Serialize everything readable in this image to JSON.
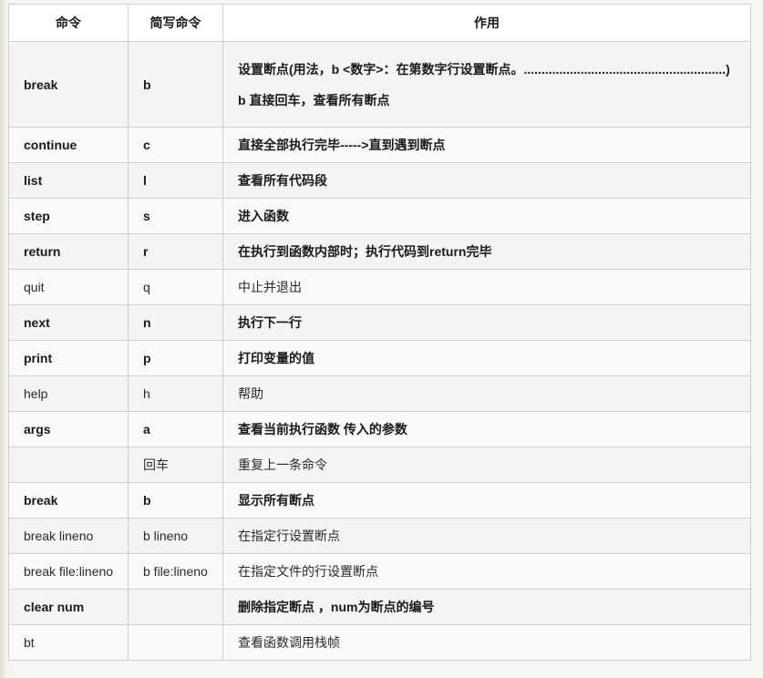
{
  "header": {
    "col1": "命令",
    "col2": "简写命令",
    "col3": "作用"
  },
  "rows": [
    {
      "cmd": "break",
      "short": "b",
      "desc": [
        "设置断点(用法，b <数字>：在第数字行设置断点。.........................................................)",
        "b 直接回车，查看所有断点"
      ],
      "bold": true
    },
    {
      "cmd": "continue",
      "short": "c",
      "desc": [
        "直接全部执行完毕----->直到遇到断点"
      ],
      "bold": true
    },
    {
      "cmd": "list",
      "short": "l",
      "desc": [
        "查看所有代码段"
      ],
      "bold": true
    },
    {
      "cmd": "step",
      "short": "s",
      "desc": [
        "进入函数"
      ],
      "bold": true
    },
    {
      "cmd": "return",
      "short": "r",
      "desc": [
        "在执行到函数内部时；执行代码到return完毕"
      ],
      "bold": true
    },
    {
      "cmd": "quit",
      "short": "q",
      "desc": [
        "中止并退出"
      ],
      "bold": false
    },
    {
      "cmd": "next",
      "short": "n",
      "desc": [
        "执行下一行"
      ],
      "bold": true
    },
    {
      "cmd": "print",
      "short": "p",
      "desc": [
        "打印变量的值"
      ],
      "bold": true
    },
    {
      "cmd": "help",
      "short": "h",
      "desc": [
        "帮助"
      ],
      "bold": false
    },
    {
      "cmd": "args",
      "short": "a",
      "desc": [
        "查看当前执行函数 传入的参数"
      ],
      "bold": true
    },
    {
      "cmd": "",
      "short": "回车",
      "desc": [
        "重复上一条命令"
      ],
      "bold": false
    },
    {
      "cmd": "break",
      "short": "b",
      "desc": [
        "显示所有断点"
      ],
      "bold": true
    },
    {
      "cmd": "break lineno",
      "short": "b lineno",
      "desc": [
        "在指定行设置断点"
      ],
      "bold": false
    },
    {
      "cmd": "break file:lineno",
      "short": "b file:lineno",
      "desc": [
        "在指定文件的行设置断点"
      ],
      "bold": false
    },
    {
      "cmd": "clear num",
      "short": "",
      "desc": [
        "删除指定断点 ，num为断点的编号"
      ],
      "bold": true
    },
    {
      "cmd": "bt",
      "short": "",
      "desc": [
        "查看函数调用栈帧"
      ],
      "bold": false
    }
  ]
}
